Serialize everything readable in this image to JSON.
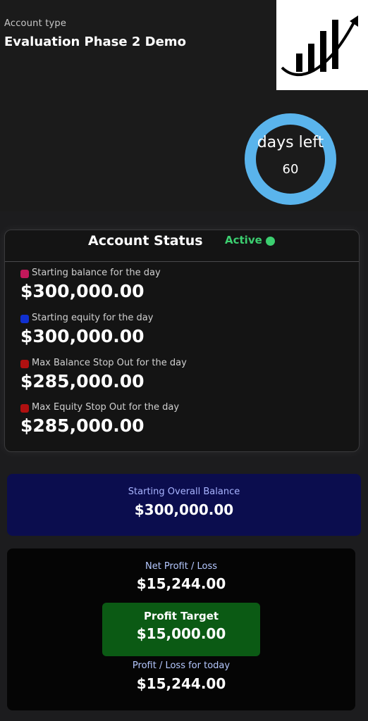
{
  "header": {
    "account_type_label": "Account type",
    "account_type_value": "Evaluation Phase 2 Demo",
    "logo_icon": "growth-chart-logo"
  },
  "days": {
    "label": "days left",
    "value": "60",
    "ring_color": "#5ab4ec"
  },
  "status": {
    "title": "Account Status",
    "state": "Active",
    "state_color": "#3ccf70",
    "metrics": [
      {
        "label": "Starting balance for the day",
        "value": "$300,000.00",
        "color": "#c2185b"
      },
      {
        "label": "Starting equity for the day",
        "value": "$300,000.00",
        "color": "#1030d0"
      },
      {
        "label": "Max Balance Stop Out for the day",
        "value": "$285,000.00",
        "color": "#b01010"
      },
      {
        "label": "Max Equity Stop Out for the day",
        "value": "$285,000.00",
        "color": "#b01010"
      }
    ]
  },
  "overall": {
    "label": "Starting Overall Balance",
    "value": "$300,000.00"
  },
  "profit": {
    "net_label": "Net Profit / Loss",
    "net_value": "$15,244.00",
    "target_label": "Profit Target",
    "target_value": "$15,000.00",
    "today_label": "Profit / Loss for today",
    "today_value": "$15,244.00"
  }
}
